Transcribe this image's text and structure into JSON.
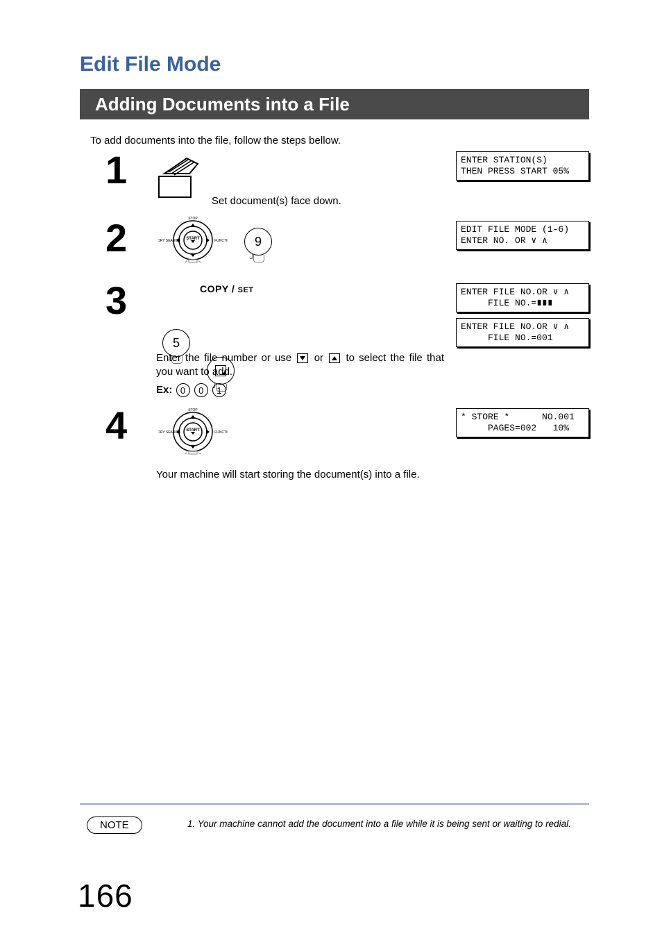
{
  "heading1": "Edit File Mode",
  "heading2": "Adding Documents into a File",
  "intro": "To add documents into the file, follow the steps bellow.",
  "pageNumber": "166",
  "steps": {
    "s1": {
      "num": "1",
      "text": "Set document(s) face down.",
      "lcd": "ENTER STATION(S)\nTHEN PRESS START 05%"
    },
    "s2": {
      "num": "2",
      "key": "9",
      "lcd": "EDIT FILE MODE (1-6)\nENTER NO. OR ∨ ∧"
    },
    "s3": {
      "num": "3",
      "copyLabel": "COPY",
      "setLabel": "SET",
      "key": "5",
      "lcdA": "ENTER FILE NO.OR ∨ ∧\n     FILE NO.=∎∎∎",
      "lcdB": "ENTER FILE NO.OR ∨ ∧\n     FILE NO.=001",
      "bodyBefore": "Enter the file number or use ",
      "bodyMiddle": " or ",
      "bodyAfter": " to select the file that you want to add.",
      "exLabel": "Ex:",
      "exDigits": [
        "0",
        "0",
        "1"
      ]
    },
    "s4": {
      "num": "4",
      "lcd": "* STORE *      NO.001\n     PAGES=002   10%",
      "body": "Your machine will start storing the document(s) into a file."
    }
  },
  "note": {
    "pill": "NOTE",
    "text": "1. Your machine cannot add the document into a file while it is being sent or waiting to redial."
  }
}
